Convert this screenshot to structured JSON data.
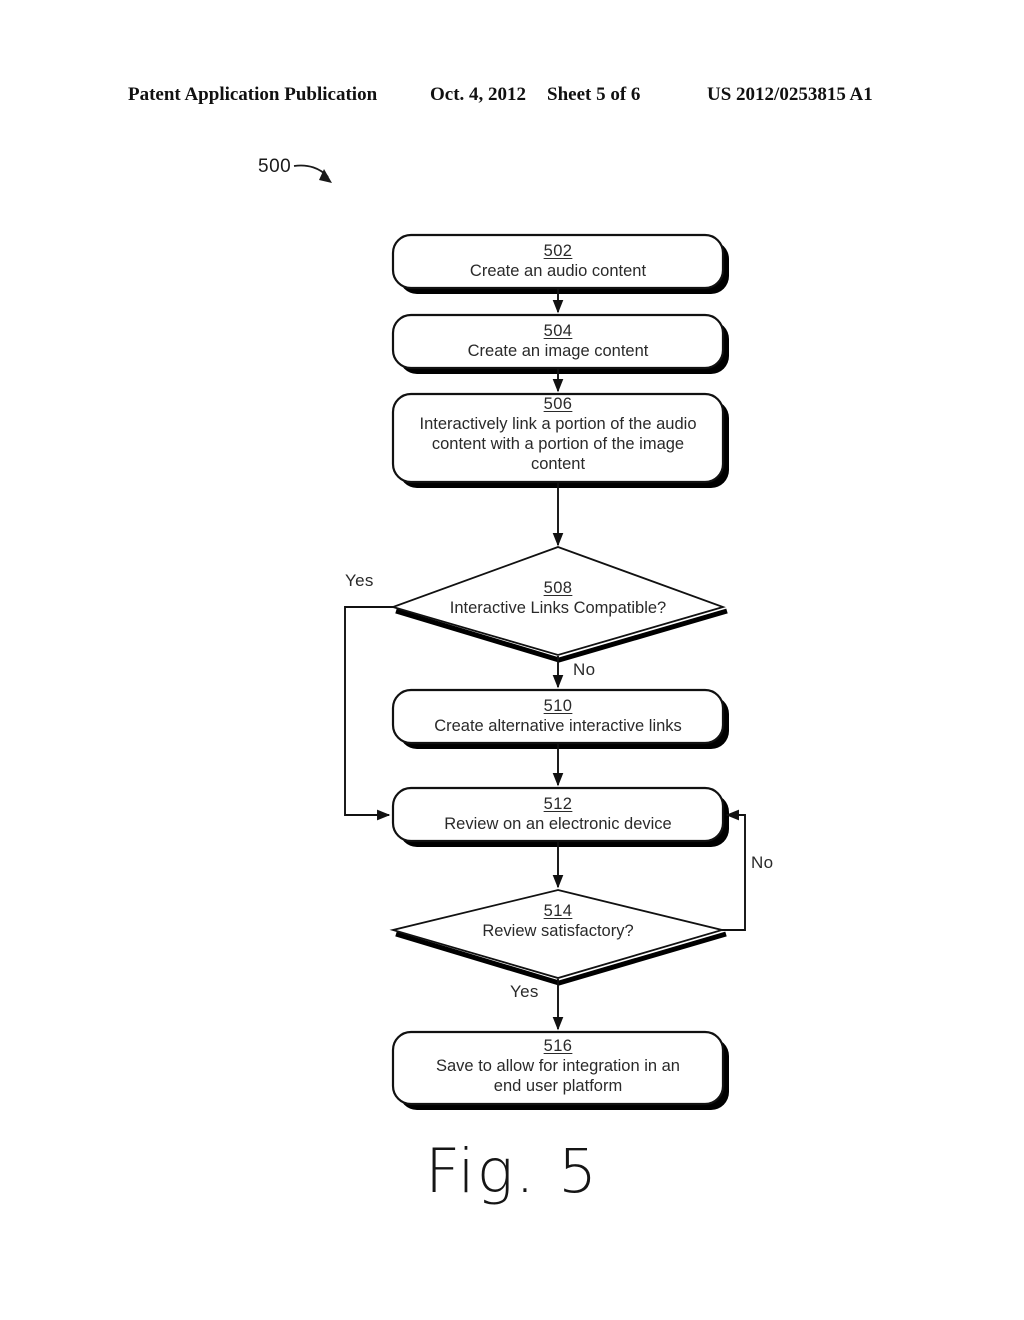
{
  "header": {
    "title": "Patent Application Publication",
    "date": "Oct. 4, 2012",
    "sheet": "Sheet 5 of 6",
    "number": "US 2012/0253815 A1"
  },
  "figure": {
    "reference_numeral": "500",
    "caption": "Fig. 5",
    "ink_color": "#1a1a1a",
    "shadow_color": "#000000",
    "background": "#ffffff"
  },
  "flowchart": {
    "type": "flowchart",
    "nodes": [
      {
        "id": "502",
        "shape": "rounded-rectangle",
        "number": "502",
        "label": "Create an audio content",
        "lines": [
          "Create an audio content"
        ]
      },
      {
        "id": "504",
        "shape": "rounded-rectangle",
        "number": "504",
        "label": "Create an image content",
        "lines": [
          "Create an image content"
        ]
      },
      {
        "id": "506",
        "shape": "rounded-rectangle",
        "number": "506",
        "label": "Interactively link a portion of the audio content with a portion of the image content",
        "lines": [
          "Interactively link a portion of the audio",
          "content with a portion of the image",
          "content"
        ]
      },
      {
        "id": "508",
        "shape": "diamond",
        "number": "508",
        "label": "Interactive Links Compatible?",
        "lines": [
          "Interactive Links Compatible?"
        ]
      },
      {
        "id": "510",
        "shape": "rounded-rectangle",
        "number": "510",
        "label": "Create alternative interactive links",
        "lines": [
          "Create alternative interactive links"
        ]
      },
      {
        "id": "512",
        "shape": "rounded-rectangle",
        "number": "512",
        "label": "Review on an electronic device",
        "lines": [
          "Review on an electronic device"
        ]
      },
      {
        "id": "514",
        "shape": "diamond",
        "number": "514",
        "label": "Review satisfactory?",
        "lines": [
          "Review satisfactory?"
        ]
      },
      {
        "id": "516",
        "shape": "rounded-rectangle",
        "number": "516",
        "label": "Save to allow for integration in an end user platform",
        "lines": [
          "Save to allow for integration in an",
          "end user platform"
        ]
      }
    ],
    "edges": [
      {
        "from": "502",
        "to": "504",
        "label": ""
      },
      {
        "from": "504",
        "to": "506",
        "label": ""
      },
      {
        "from": "506",
        "to": "508",
        "label": ""
      },
      {
        "from": "508",
        "to": "512",
        "label": "Yes"
      },
      {
        "from": "508",
        "to": "510",
        "label": "No"
      },
      {
        "from": "510",
        "to": "512",
        "label": ""
      },
      {
        "from": "512",
        "to": "514",
        "label": ""
      },
      {
        "from": "514",
        "to": "516",
        "label": "Yes"
      },
      {
        "from": "514",
        "to": "512",
        "label": "No"
      }
    ],
    "edge_labels": {
      "yes_508": "Yes",
      "no_508": "No",
      "yes_514": "Yes",
      "no_514": "No"
    }
  }
}
